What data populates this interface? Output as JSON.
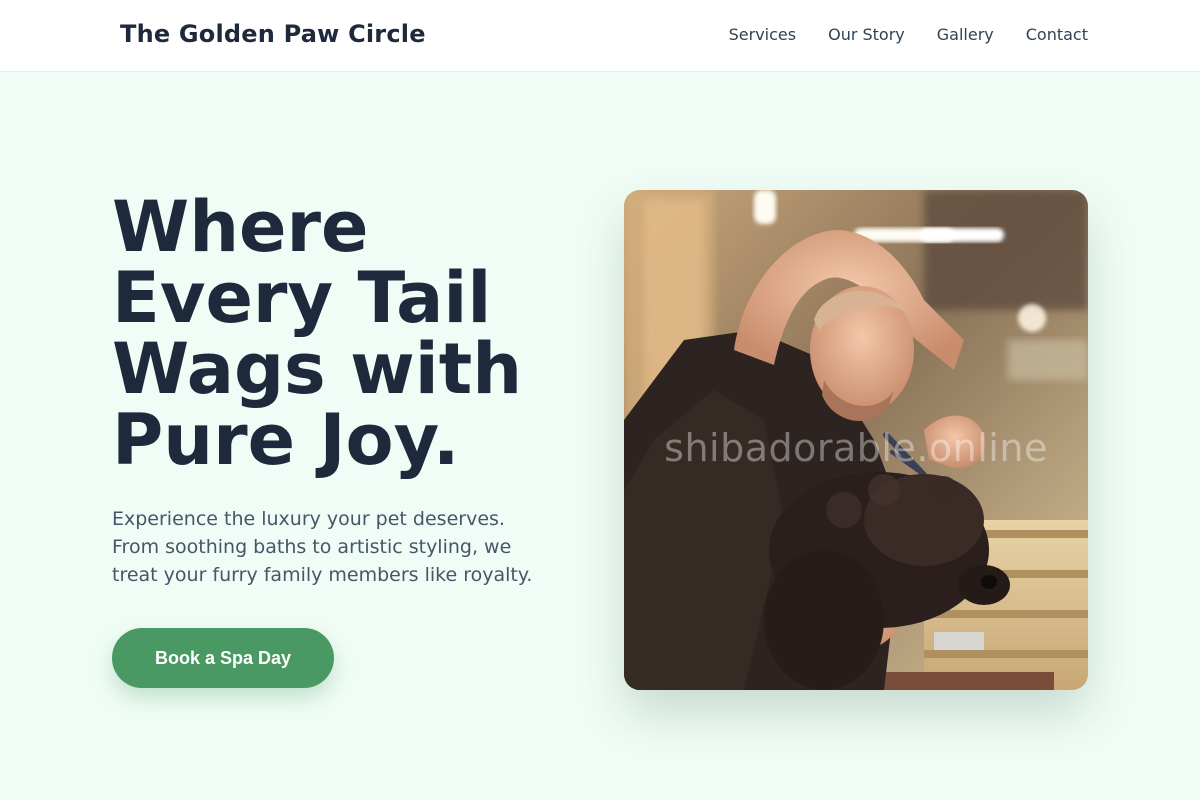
{
  "header": {
    "brand": "The Golden Paw Circle",
    "nav": [
      "Services",
      "Our Story",
      "Gallery",
      "Contact"
    ]
  },
  "hero": {
    "title_lines": [
      "Where",
      "Every Tail",
      "Wags with",
      "Pure Joy."
    ],
    "subtitle_lines": [
      "Experience the luxury your pet deserves.",
      "From soothing baths to artistic styling, we",
      "treat your furry family members like royalty."
    ],
    "cta_label": "Book a Spa Day"
  },
  "photo": {
    "watermark": "shibadorable.online"
  },
  "colors": {
    "background": "#f0fdf6",
    "heading": "#1e293b",
    "body_text": "#475569",
    "accent": "#4a9863",
    "nav_bg": "#ffffff"
  }
}
